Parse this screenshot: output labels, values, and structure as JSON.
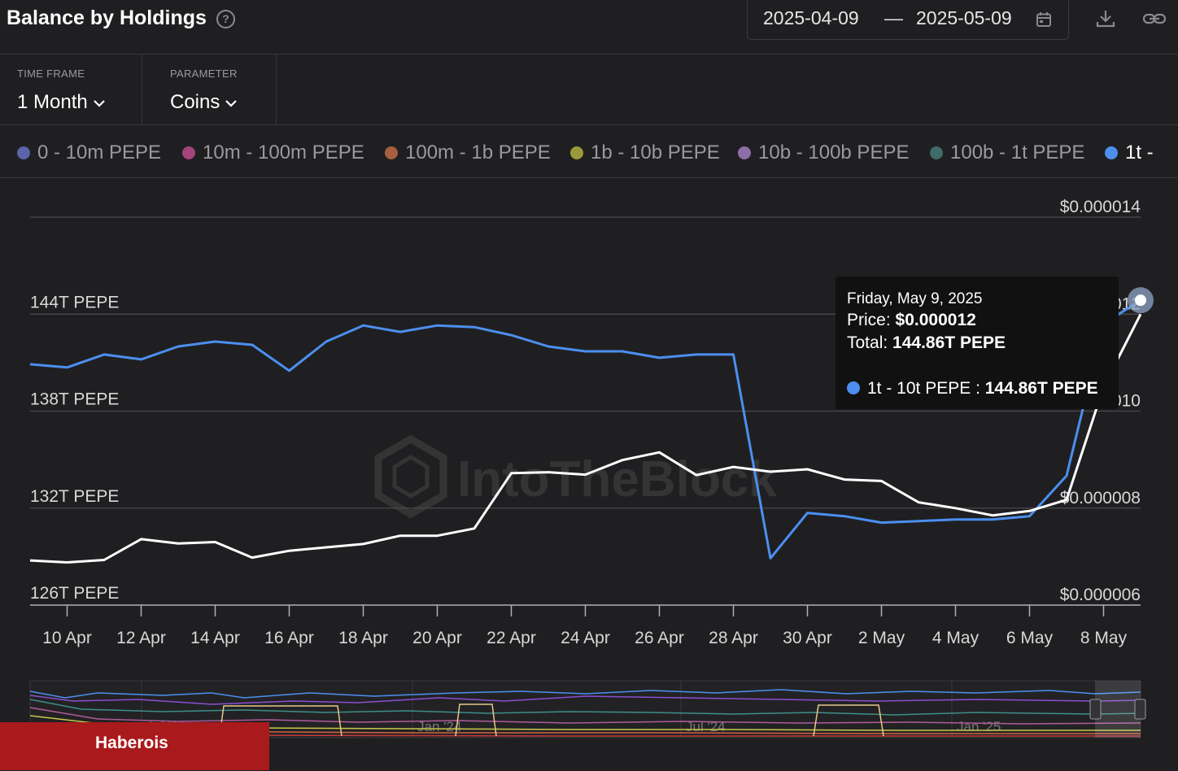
{
  "header": {
    "title": "Balance by Holdings",
    "help_icon": "question-circle-icon",
    "date_from": "2025-04-09",
    "date_separator": "—",
    "date_to": "2025-05-09",
    "calendar_icon": "calendar-icon",
    "download_icon": "download-icon",
    "link_icon": "link-icon"
  },
  "filters": {
    "time_frame": {
      "label": "TIME FRAME",
      "value": "1 Month"
    },
    "parameter": {
      "label": "PARAMETER",
      "value": "Coins"
    }
  },
  "legend": [
    {
      "label": "0 - 10m PEPE",
      "color": "#5b64a8"
    },
    {
      "label": "10m - 100m PEPE",
      "color": "#a3457a"
    },
    {
      "label": "100m - 1b PEPE",
      "color": "#a55f3f"
    },
    {
      "label": "1b - 10b PEPE",
      "color": "#9a9a3c"
    },
    {
      "label": "10b - 100b PEPE",
      "color": "#8c6ea8"
    },
    {
      "label": "100b - 1t PEPE",
      "color": "#3f6b68"
    },
    {
      "label": "1t -",
      "color": "#4c8fef"
    }
  ],
  "tooltip": {
    "date": "Friday, May 9, 2025",
    "price_label": "Price:",
    "price_value": "$0.000012",
    "total_label": "Total:",
    "total_value": "144.86T PEPE",
    "series_label": "1t - 10t PEPE :",
    "series_value": "144.86T PEPE"
  },
  "watermark": "IntoTheBlock",
  "credit": "Haberois",
  "chart_data": {
    "type": "line",
    "x": [
      "2025-04-09",
      "2025-04-10",
      "2025-04-11",
      "2025-04-12",
      "2025-04-13",
      "2025-04-14",
      "2025-04-15",
      "2025-04-16",
      "2025-04-17",
      "2025-04-18",
      "2025-04-19",
      "2025-04-20",
      "2025-04-21",
      "2025-04-22",
      "2025-04-23",
      "2025-04-24",
      "2025-04-25",
      "2025-04-26",
      "2025-04-27",
      "2025-04-28",
      "2025-04-29",
      "2025-04-30",
      "2025-05-01",
      "2025-05-02",
      "2025-05-03",
      "2025-05-04",
      "2025-05-05",
      "2025-05-06",
      "2025-05-07",
      "2025-05-08",
      "2025-05-09"
    ],
    "x_tick_labels": [
      "10 Apr",
      "12 Apr",
      "14 Apr",
      "16 Apr",
      "18 Apr",
      "20 Apr",
      "22 Apr",
      "24 Apr",
      "26 Apr",
      "28 Apr",
      "30 Apr",
      "2 May",
      "4 May",
      "6 May",
      "8 May"
    ],
    "y_left": {
      "ticks": [
        "126T PEPE",
        "132T PEPE",
        "138T PEPE",
        "144T PEPE"
      ],
      "range": [
        126,
        150
      ],
      "unit": "T PEPE"
    },
    "y_right": {
      "ticks": [
        "$0.000006",
        "$0.000008",
        "$0.000010",
        "$0.000012",
        "$0.000014"
      ],
      "range": [
        6e-06,
        1.4e-05
      ]
    },
    "grid": true,
    "series": [
      {
        "name": "1t - 10t PEPE",
        "axis": "left",
        "color": "#4c8fef",
        "values": [
          140.9,
          140.7,
          141.5,
          141.2,
          142.0,
          142.3,
          142.1,
          140.5,
          142.3,
          143.3,
          142.9,
          143.3,
          143.2,
          142.7,
          142.0,
          141.7,
          141.7,
          141.3,
          141.5,
          141.5,
          128.9,
          131.7,
          131.5,
          131.1,
          131.2,
          131.3,
          131.3,
          131.5,
          134.0,
          143.4,
          144.86
        ]
      },
      {
        "name": "Price",
        "axis": "right",
        "color": "#ffffff",
        "values": [
          6.92e-06,
          6.88e-06,
          6.93e-06,
          7.36e-06,
          7.27e-06,
          7.3e-06,
          6.98e-06,
          7.12e-06,
          7.19e-06,
          7.26e-06,
          7.43e-06,
          7.43e-06,
          7.58e-06,
          8.72e-06,
          8.74e-06,
          8.69e-06,
          8.99e-06,
          9.15e-06,
          8.68e-06,
          8.85e-06,
          8.75e-06,
          8.8e-06,
          8.59e-06,
          8.56e-06,
          8.12e-06,
          8e-06,
          7.85e-06,
          7.94e-06,
          8.17e-06,
          1.05e-05,
          1.2e-05
        ]
      }
    ]
  }
}
